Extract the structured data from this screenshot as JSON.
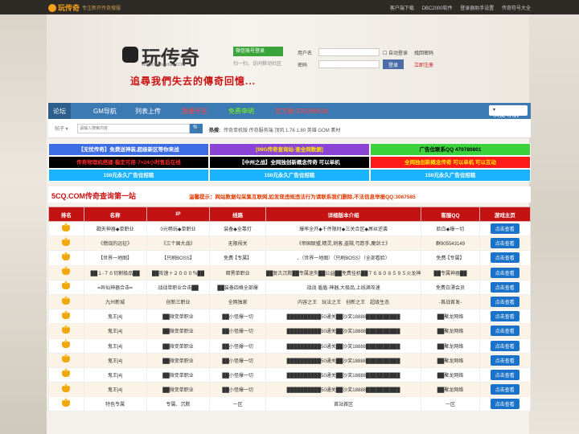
{
  "topbar": {
    "logo": "玩传奇",
    "slogan": "专注新开传奇搜服",
    "links": [
      "客户端下载",
      "DBC2000软件",
      "登录器助手设置",
      "传奇符号大全"
    ]
  },
  "header": {
    "brand": "玩传奇",
    "brand_sub": "WWW.WanWirbba.COM",
    "tagline": "追尋我們失去的傳奇回憶..."
  },
  "login": {
    "wechat_button": "微信账号登录",
    "wechat_sub": "扫一扫，访问移动社区",
    "username_label": "用户名",
    "password_label": "密码",
    "auto_login": "自动登录",
    "forgot": "找回密码",
    "register": "立即注册",
    "login_button": "登录"
  },
  "nav": {
    "items": [
      "论坛",
      "GM导航",
      "列表上传",
      "我要开区",
      "免费申明",
      "官方群:339288648"
    ],
    "quick": "快捷导航"
  },
  "search": {
    "type": "帖子",
    "placeholder": "请输入搜索内容",
    "button": "🔍",
    "hot_label": "热搜:",
    "hot_terms": "传奇单机版 传奇服务端 顶风 1.76 1.80 英雄 GOM 素材"
  },
  "ads": [
    [
      {
        "text": "【无忧传奇】免费送神装,超级新区等你来战",
        "bg": "#3d6de4",
        "fg": "#ffffff"
      },
      {
        "text": "[99G传奇查询站-查全网数据]",
        "bg": "#8c44d6",
        "fg": "#ffe600"
      },
      {
        "text": "广告位联系QQ 470780801",
        "bg": "#3cd23c",
        "fg": "#000000"
      }
    ],
    [
      {
        "text": "传奇物理机搭建-稳定可用-7×24小时售后在线",
        "bg": "#000000",
        "fg": "#ff2a2a"
      },
      {
        "text": "【中州之战】全网独创新概念传奇 可以单机",
        "bg": "#000000",
        "fg": "#ffffff"
      },
      {
        "text": "全网独创新概念传奇 可以单机 可以互动",
        "bg": "#ff1a1a",
        "fg": "#ffe600"
      }
    ],
    [
      {
        "text": "150元永久广告位招租",
        "bg": "#1ab3ff",
        "fg": "#ffffff"
      },
      {
        "text": "150元永久广告位招租",
        "bg": "#1ab3ff",
        "fg": "#ffffff"
      },
      {
        "text": "150元永久广告位招租",
        "bg": "#1ab3ff",
        "fg": "#ffffff"
      }
    ]
  ],
  "site": {
    "title": "5CQ.COM传奇查询第一站",
    "notice": "温馨提示：网站数据勾采集互联网,如发现违规违法行为请联系我们删除,不法信息举报QQ:3067585"
  },
  "table": {
    "headers": [
      "排名",
      "名称",
      "IP",
      "线路",
      "详细版本介绍",
      "客服QQ",
      "游戏主页"
    ],
    "button": "点击查看",
    "rows": [
      [
        "戳天神器◆单职业",
        "0元畅玩◆单职业",
        "装备◆全靠打",
        "爆率全开◆千件限时◆三关合区◆屌丝逆袭",
        "脸白◆爆一切"
      ],
      [
        "《燃烧的远征》",
        "《三个国大战》",
        "无限闯关",
        "《帝国联盟,精灵,刺客,盗贼,弓箭手,魔剑士》",
        "群905543149"
      ],
      [
        "【世界一地图】",
        "【只刷BOSS】",
        "免费·【专属】",
        "．（世界一地图）（只刷BOSS）（全部看脸）",
        "免费·【专属】"
      ],
      [
        "██１-７６切割极品██",
        "██攻速＋２０００％██",
        "暗黑单职业",
        "██复古沉默██专属迷失██公益██免费挂机██７６８０８５９５火龙神",
        "██专属神器██"
      ],
      [
        "━异仙神器合击━",
        "战战单职业合击██",
        "██装备四格全部爆",
        "战战·盾盾·神器,大极品,上线满攻速",
        "免费白漂会员"
      ],
      [
        "九州新城",
        "创新三职业",
        "全网独家",
        "内容之王　玩法之王　创新之王　超级生态",
        "-首战首发-"
      ],
      [
        "鬼王|4|",
        "██微变单职业",
        "██小怪爆一切",
        "██████████50通关██沙奖18888██████████",
        "██聚龙网络"
      ],
      [
        "鬼王|4|",
        "██微变单职业",
        "██小怪爆一切",
        "██████████50通关██沙奖18888██████████",
        "██聚龙网络"
      ],
      [
        "鬼王|4|",
        "██微变单职业",
        "██小怪爆一切",
        "██████████50通关██沙奖18888██████████",
        "██聚龙网络"
      ],
      [
        "鬼王|4|",
        "██微变单职业",
        "██小怪爆一切",
        "██████████50通关██沙奖18888██████████",
        "██聚龙网络"
      ],
      [
        "鬼王|4|",
        "██微变单职业",
        "██小怪爆一切",
        "██████████50通关██沙奖18888██████████",
        "██聚龙网络"
      ],
      [
        "鬼王|4|",
        "██微变单职业",
        "██小怪爆一切",
        "██████████50通关██沙奖18888██████████",
        "██聚龙网络"
      ],
      [
        "特色专属",
        "专属、沉默",
        "一区",
        "首站首区",
        "一区"
      ]
    ]
  }
}
